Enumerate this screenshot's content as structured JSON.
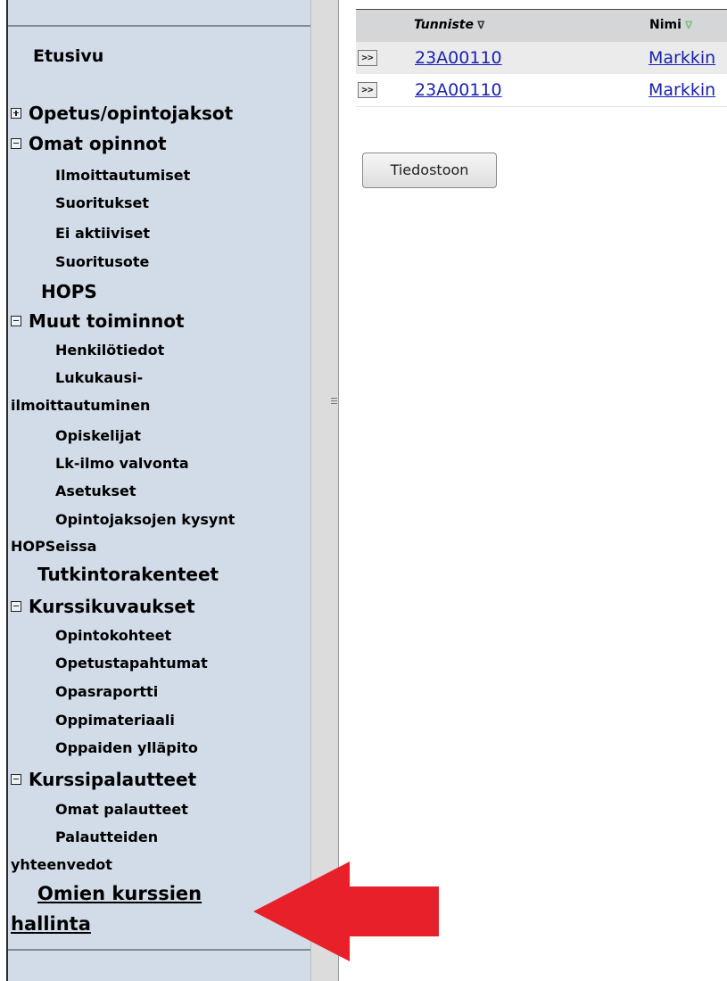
{
  "sidebar": {
    "home": "Etusivu",
    "sections": {
      "opetus": "Opetus/opintojaksot",
      "omat_opinnot": "Omat opinnot",
      "ilmoittautumiset": "Ilmoittautumiset",
      "suoritukset": "Suoritukset",
      "ei_aktiiviset": "Ei aktiiviset",
      "suoritusote": "Suoritusote",
      "hops": "HOPS",
      "muut_toiminnot": "Muut toiminnot",
      "henkilotiedot": "Henkilötiedot",
      "lukukausi_1": "Lukukausi-",
      "lukukausi_2": "ilmoittautuminen",
      "opiskelijat": "Opiskelijat",
      "lk_ilmo": "Lk-ilmo valvonta",
      "asetukset": "Asetukset",
      "kysynta_1": "Opintojaksojen kysynt",
      "kysynta_2": "HOPSeissa",
      "tutkintorakenteet": "Tutkintorakenteet",
      "kurssikuvaukset": "Kurssikuvaukset",
      "opintokohteet": "Opintokohteet",
      "opetustapahtumat": "Opetustapahtumat",
      "opasraportti": "Opasraportti",
      "oppimateriaali": "Oppimateriaali",
      "oppaiden_yllapito": "Oppaiden ylläpito",
      "kurssipalautteet": "Kurssipalautteet",
      "omat_palautteet": "Omat palautteet",
      "palautteiden_1": "Palautteiden",
      "palautteiden_2": "yhteenvedot",
      "omien_kurssien_1": "Omien kurssien",
      "omien_kurssien_2": "hallinta"
    }
  },
  "grid": {
    "headers": {
      "tunniste": "Tunniste",
      "nimi": "Nimi"
    },
    "sort_glyph": "∇",
    "expander_label": ">>",
    "rows": [
      {
        "tunniste": "23A00110",
        "nimi": "Markkin"
      },
      {
        "tunniste": "23A00110",
        "nimi": "Markkin"
      }
    ]
  },
  "export_button": "Tiedostoon",
  "colors": {
    "sidebar_bg": "#d2dce8",
    "link": "#1a22b0",
    "arrow": "#e8202a"
  }
}
